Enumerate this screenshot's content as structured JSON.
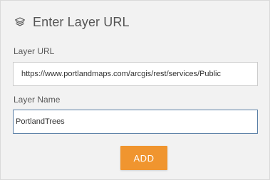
{
  "header": {
    "icon": "layers-icon",
    "title": "Enter Layer URL"
  },
  "form": {
    "url_label": "Layer URL",
    "url_value": "https://www.portlandmaps.com/arcgis/rest/services/Public",
    "name_label": "Layer Name",
    "name_value": "PortlandTrees",
    "add_label": "ADD"
  },
  "colors": {
    "panel_bg": "#f2f2f2",
    "accent": "#f0952f",
    "focus_border": "#5a7fa6"
  }
}
